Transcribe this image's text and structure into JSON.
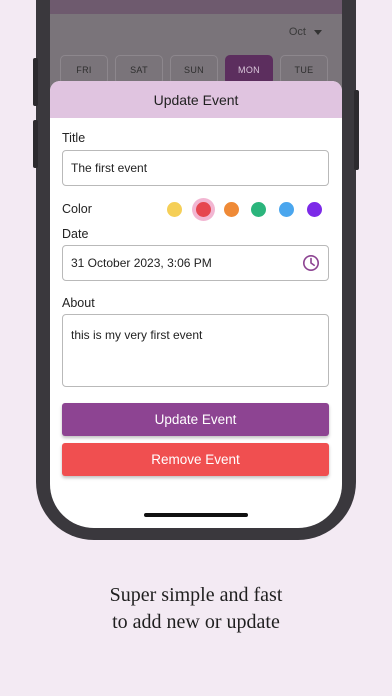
{
  "calendar": {
    "month": "Oct",
    "days": [
      "FRI",
      "SAT",
      "SUN",
      "MON",
      "TUE"
    ],
    "active_day": "MON"
  },
  "sheet": {
    "title": "Update Event",
    "title_label": "Title",
    "title_value": "The first event",
    "color_label": "Color",
    "colors": [
      "#f5cf57",
      "#e6464f",
      "#ef8a37",
      "#2bb57c",
      "#4aa6ee",
      "#7c2ae8"
    ],
    "selected_color": "#e6464f",
    "date_label": "Date",
    "date_value": "31 October 2023, 3:06 PM",
    "about_label": "About",
    "about_value": "this is my very first event",
    "update_button": "Update Event",
    "remove_button": "Remove Event",
    "update_color": "#8d4492",
    "remove_color": "#f04f50"
  },
  "caption": {
    "line1": "Super simple and fast",
    "line2": "to add new or update"
  }
}
